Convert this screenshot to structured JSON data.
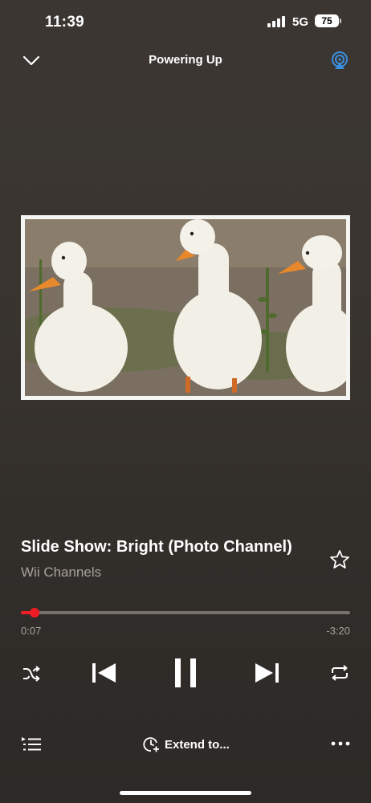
{
  "status_bar": {
    "time": "11:39",
    "network": "5G",
    "battery": "75"
  },
  "header": {
    "title": "Powering Up",
    "collapse_icon": "chevron-down-icon",
    "cast_icon": "airplay-icon",
    "accent_color": "#3b8fe0"
  },
  "now_playing": {
    "title": "Slide Show: Bright (Photo Channel)",
    "artist": "Wii Channels",
    "artwork": "three white ducks standing on gravel and grass",
    "favorite_icon": "star-outline-icon"
  },
  "playback": {
    "elapsed": "0:07",
    "remaining": "-3:20",
    "progress_fraction": 0.035,
    "progress_color": "#ee1c25"
  },
  "controls": {
    "shuffle_icon": "shuffle-icon",
    "previous_icon": "skip-previous-icon",
    "pause_icon": "pause-icon",
    "next_icon": "skip-next-icon",
    "repeat_icon": "repeat-icon"
  },
  "bottom_bar": {
    "queue_icon": "queue-icon",
    "extend_label": "Extend to...",
    "extend_icon": "timer-add-icon",
    "more_icon": "more-horizontal-icon"
  }
}
